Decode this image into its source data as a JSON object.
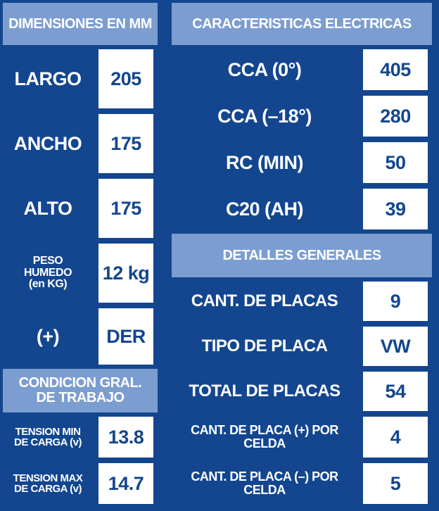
{
  "left": {
    "dimensions_header": "DIMENSIONES EN MM",
    "rows": [
      {
        "label": "LARGO",
        "value": "205"
      },
      {
        "label": "ANCHO",
        "value": "175"
      },
      {
        "label": "ALTO",
        "value": "175"
      },
      {
        "label_lines": [
          "PESO",
          "HUMEDO",
          "(en KG)"
        ],
        "value": "12 kg"
      },
      {
        "label": "(+)",
        "value": "DER"
      }
    ],
    "conditions_header": [
      "CONDICION GRAL.",
      "DE TRABAJO"
    ],
    "conditions": [
      {
        "label_lines": [
          "TENSION MIN",
          "DE CARGA (v)"
        ],
        "value": "13.8"
      },
      {
        "label_lines": [
          "TENSION MAX",
          "DE CARGA (v)"
        ],
        "value": "14.7"
      }
    ]
  },
  "right": {
    "electrical_header": "CARACTERISTICAS ELECTRICAS",
    "electrical": [
      {
        "label": "CCA (0°)",
        "value": "405"
      },
      {
        "label": "CCA (–18°)",
        "value": "280"
      },
      {
        "label": "RC (MIN)",
        "value": "50"
      },
      {
        "label": "C20 (AH)",
        "value": "39"
      }
    ],
    "general_header": "DETALLES GENERALES",
    "general": [
      {
        "label": "CANT. DE PLACAS",
        "value": "9"
      },
      {
        "label": "TIPO DE PLACA",
        "value": "VW"
      },
      {
        "label": "TOTAL DE PLACAS",
        "value": "54"
      },
      {
        "label": "CANT. DE PLACA (+) POR CELDA",
        "value": "4"
      },
      {
        "label": "CANT. DE PLACA (–) POR CELDA",
        "value": "5"
      }
    ]
  },
  "colors": {
    "dark_blue": "#13468f",
    "light_blue": "#7c9dd0",
    "white": "#ffffff"
  }
}
